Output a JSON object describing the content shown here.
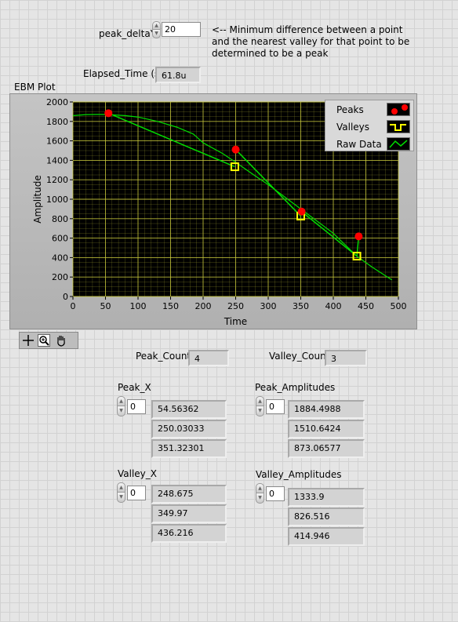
{
  "peak_delta": {
    "label": "peak_deltaY",
    "value": "20"
  },
  "hint": {
    "line1": "<-- Minimum difference between a point",
    "line2": "and the nearest valley for that point to be",
    "line3": "determined to be a peak"
  },
  "elapsed": {
    "label": "Elapsed_Time (s)",
    "value": "61.8u"
  },
  "graph": {
    "title": "EBM Plot",
    "legend": [
      "Peaks",
      "Valleys",
      "Raw Data"
    ]
  },
  "colors": {
    "plot_bg": "#000000",
    "grid": "#c8c83c",
    "raw": "#00dd00",
    "peak": "#ff0000",
    "valley": "#ffff00"
  },
  "icons": [
    "crosshair-tool-icon",
    "zoom-tool-icon",
    "pan-hand-tool-icon"
  ],
  "chart_data": {
    "type": "line",
    "xlabel": "Time",
    "ylabel": "Amplitude",
    "xlim": [
      0,
      500
    ],
    "ylim": [
      0,
      2000
    ],
    "xticks": [
      "0",
      "50",
      "100",
      "150",
      "200",
      "250",
      "300",
      "350",
      "400",
      "450",
      "500"
    ],
    "yticks": [
      "0",
      "200",
      "400",
      "600",
      "800",
      "1000",
      "1200",
      "1400",
      "1600",
      "1800",
      "2000"
    ],
    "grid": true,
    "legend_position": "top-right",
    "series": [
      {
        "name": "Raw Data",
        "style": "line",
        "x": [
          0,
          20,
          40,
          55,
          80,
          100,
          130,
          160,
          185,
          200,
          230,
          250,
          280,
          300,
          330,
          350,
          380,
          400,
          420,
          436,
          460,
          490
        ],
        "y": [
          1860,
          1870,
          1872,
          1870,
          1860,
          1845,
          1800,
          1740,
          1670,
          1580,
          1470,
          1380,
          1240,
          1150,
          1000,
          900,
          750,
          650,
          520,
          415,
          300,
          170
        ]
      },
      {
        "name": "Peaks",
        "style": "points",
        "x": [
          54.56362,
          250.03033,
          351.32301
        ],
        "y": [
          1884.4988,
          1510.6424,
          873.06577
        ]
      },
      {
        "name": "Valleys",
        "style": "points",
        "x": [
          248.675,
          349.97,
          436.216
        ],
        "y": [
          1333.9,
          826.516,
          414.946
        ]
      }
    ],
    "annotation_points": [
      {
        "series": "Peaks",
        "x": 439,
        "y": 618
      }
    ]
  },
  "peak_count": {
    "label": "Peak_Count",
    "value": "4"
  },
  "valley_count": {
    "label": "Valley_Count",
    "value": "3"
  },
  "peak_x": {
    "label": "Peak_X",
    "index": "0",
    "values": [
      "54.56362",
      "250.03033",
      "351.32301"
    ]
  },
  "peak_amp": {
    "label": "Peak_Amplitudes",
    "index": "0",
    "values": [
      "1884.4988",
      "1510.6424",
      "873.06577"
    ]
  },
  "valley_x": {
    "label": "Valley_X",
    "index": "0",
    "values": [
      "248.675",
      "349.97",
      "436.216"
    ]
  },
  "valley_amp": {
    "label": "Valley_Amplitudes",
    "index": "0",
    "values": [
      "1333.9",
      "826.516",
      "414.946"
    ]
  }
}
